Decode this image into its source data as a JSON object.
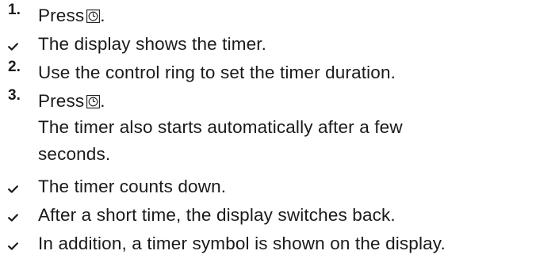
{
  "steps": [
    {
      "marker": "1.",
      "type": "number",
      "text": "Press",
      "icon": "timer-button-icon",
      "trailing": "."
    },
    {
      "marker": "check",
      "type": "result",
      "text": "The display shows the timer."
    },
    {
      "marker": "2.",
      "type": "number",
      "text": "Use the control ring to set the timer duration."
    },
    {
      "marker": "3.",
      "type": "number",
      "text": "Press",
      "icon": "timer-button-icon",
      "trailing": "."
    },
    {
      "note_lines": [
        "The timer also starts automatically after a few",
        "seconds."
      ]
    },
    {
      "marker": "check",
      "type": "result",
      "text": "The timer counts down."
    },
    {
      "marker": "check",
      "type": "result",
      "text": "After a short time, the display switches back."
    },
    {
      "marker": "check",
      "type": "result",
      "text": "In addition, a timer symbol is shown on the display."
    }
  ]
}
